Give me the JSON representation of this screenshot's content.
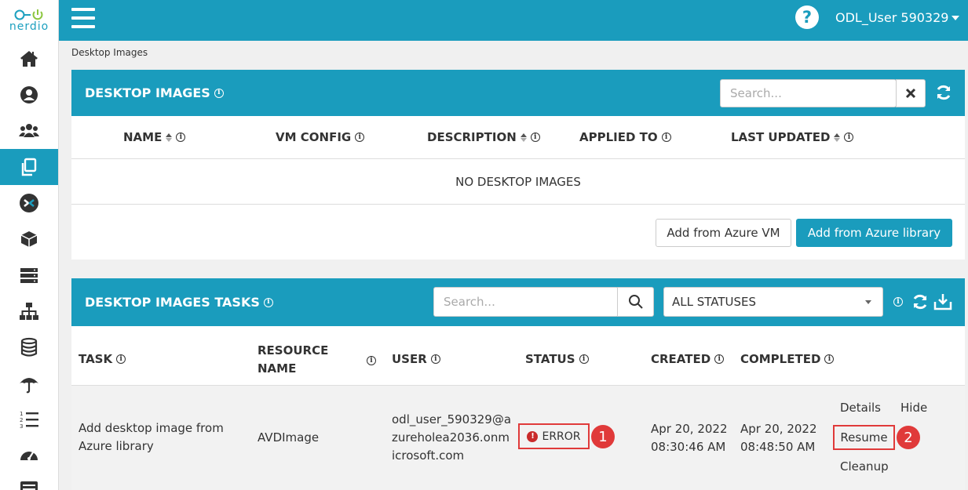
{
  "app": {
    "logo_text": "nerdio",
    "user_label": "ODL_User 590329",
    "help_glyph": "?"
  },
  "sidebar": {
    "items": [
      {
        "name": "home-icon"
      },
      {
        "name": "user-icon"
      },
      {
        "name": "users-group-icon"
      },
      {
        "name": "copy-icon",
        "active": true
      },
      {
        "name": "remote-desktop-icon"
      },
      {
        "name": "box-icon"
      },
      {
        "name": "server-icon"
      },
      {
        "name": "network-icon"
      },
      {
        "name": "database-icon"
      },
      {
        "name": "umbrella-icon"
      },
      {
        "name": "list-ol-icon"
      },
      {
        "name": "dashboard-gauge-icon"
      },
      {
        "name": "list-alt-icon"
      }
    ]
  },
  "breadcrumb": "Desktop Images",
  "desktop_images": {
    "title": "DESKTOP IMAGES",
    "search_placeholder": "Search...",
    "columns": [
      "NAME",
      "VM CONFIG",
      "DESCRIPTION",
      "APPLIED TO",
      "LAST UPDATED"
    ],
    "empty_message": "NO DESKTOP IMAGES",
    "add_from_vm": "Add from Azure VM",
    "add_from_library": "Add from Azure library"
  },
  "tasks": {
    "title": "DESKTOP IMAGES TASKS",
    "search_placeholder": "Search...",
    "status_filter": "ALL STATUSES",
    "columns": {
      "task": "TASK",
      "resource_name_1": "RESOURCE",
      "resource_name_2": "NAME",
      "user": "USER",
      "status": "STATUS",
      "created": "CREATED",
      "completed": "COMPLETED"
    },
    "rows": [
      {
        "task_1": "Add desktop image from",
        "task_2": "Azure library",
        "resource": "AVDImage",
        "user_1": "odl_user_590329@a",
        "user_2": "zureholea2036.onm",
        "user_3": "icrosoft.com",
        "status": "ERROR",
        "created_date": "Apr 20, 2022",
        "created_time": "08:30:46 AM",
        "completed_date": "Apr 20, 2022",
        "completed_time": "08:48:50 AM",
        "actions": {
          "details": "Details",
          "hide": "Hide",
          "resume": "Resume",
          "cleanup": "Cleanup"
        }
      }
    ]
  },
  "callouts": {
    "one": "1",
    "two": "2"
  },
  "colors": {
    "accent": "#1a9cbd",
    "error": "#e03a3a"
  }
}
